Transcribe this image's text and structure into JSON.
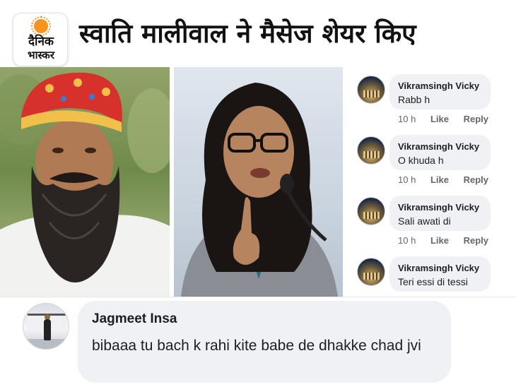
{
  "header": {
    "logo_line1": "दैनिक",
    "logo_line2": "भास्कर",
    "headline": "स्वाति मालीवाल ने मैसेज शेयर किए",
    "logo_accent": "#f7941d"
  },
  "comments": [
    {
      "name": "Vikramsingh Vicky",
      "text": "Rabb h",
      "time": "10 h",
      "like": "Like",
      "reply": "Reply"
    },
    {
      "name": "Vikramsingh Vicky",
      "text": "O khuda h",
      "time": "10 h",
      "like": "Like",
      "reply": "Reply"
    },
    {
      "name": "Vikramsingh Vicky",
      "text": "Sali awati di",
      "time": "10 h",
      "like": "Like",
      "reply": "Reply"
    },
    {
      "name": "Vikramsingh Vicky",
      "text": "Teri essi di tessi"
    }
  ],
  "big_comment": {
    "name": "Jagmeet Insa",
    "text": "bibaaa tu bach k rahi kite babe de dhakke chad jvi"
  },
  "colors": {
    "bubble": "#eff1f4",
    "meta_text": "#65676b",
    "text": "#1c1e21"
  }
}
